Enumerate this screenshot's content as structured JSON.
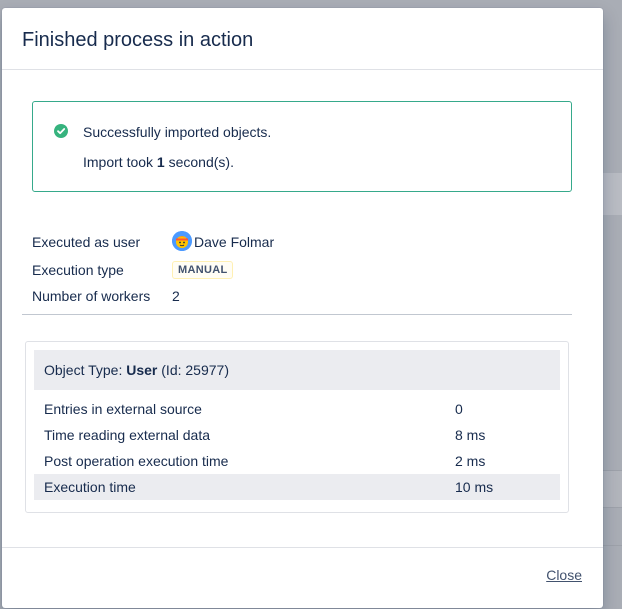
{
  "modal": {
    "title": "Finished process in action"
  },
  "success": {
    "message": "Successfully imported objects.",
    "import_prefix": "Import took ",
    "import_value": "1",
    "import_suffix": " second(s).",
    "color": "#36b37e"
  },
  "meta": {
    "executed_as_label": "Executed as user",
    "executed_as_value": "Dave Folmar",
    "execution_type_label": "Execution type",
    "execution_type_value": "MANUAL",
    "workers_label": "Number of workers",
    "workers_value": "2"
  },
  "table": {
    "header_prefix": "Object Type: ",
    "header_type": "User",
    "header_suffix": " (Id: 25977)",
    "rows": [
      {
        "label": "Entries in external source",
        "value": "0"
      },
      {
        "label": "Time reading external data",
        "value": "8 ms"
      },
      {
        "label": "Post operation execution time",
        "value": "2 ms"
      },
      {
        "label": "Execution time",
        "value": "10 ms"
      }
    ]
  },
  "footer": {
    "close_label": "Close"
  }
}
